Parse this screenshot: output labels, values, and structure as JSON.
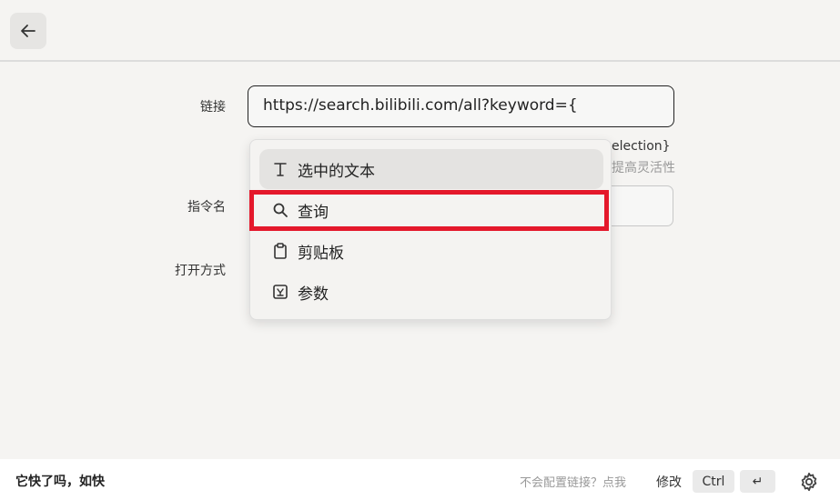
{
  "form": {
    "link_label": "链接",
    "link_value": "https://search.bilibili.com/all?keyword={",
    "hint_line1": "election}",
    "hint_line2": "提高灵活性",
    "command_label": "指令名",
    "open_label": "打开方式"
  },
  "dropdown": {
    "items": [
      {
        "label": "选中的文本",
        "icon": "text-icon"
      },
      {
        "label": "查询",
        "icon": "search-icon"
      },
      {
        "label": "剪贴板",
        "icon": "clipboard-icon"
      },
      {
        "label": "参数",
        "icon": "parameter-icon"
      }
    ]
  },
  "footer": {
    "title": "它快了吗，如快",
    "help": "不会配置链接？点我",
    "edit": "修改",
    "key_ctrl": "Ctrl",
    "key_enter": "↵"
  },
  "colors": {
    "highlight": "#e4182b",
    "background": "#f5f4f2"
  }
}
